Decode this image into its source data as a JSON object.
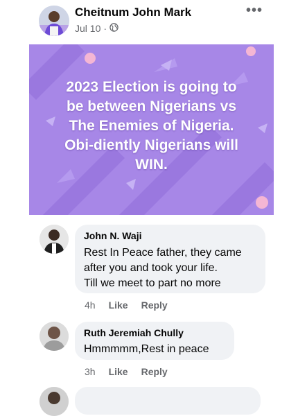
{
  "post": {
    "author": "Cheitnum John Mark",
    "date": "Jul 10",
    "separator": "·",
    "privacy_icon": "globe-icon",
    "more_label": "•••",
    "text": "2023 Election is going to\nbe between Nigerians vs\nThe Enemies of Nigeria.\nObi-diently Nigerians will\nWIN.",
    "background_color": "#a787e7"
  },
  "comments": [
    {
      "author": "John N. Waji",
      "lines": [
        "Rest In Peace father, they came",
        "after you and took your life.",
        "Till we meet to part no more"
      ],
      "time": "4h",
      "like": "Like",
      "reply": "Reply"
    },
    {
      "author": "Ruth Jeremiah Chully",
      "lines": [
        "Hmmmmm,Rest in peace"
      ],
      "time": "3h",
      "like": "Like",
      "reply": "Reply"
    }
  ],
  "colors": {
    "secondary_text": "#65676b",
    "bubble_bg": "#f0f2f5",
    "card_bg": "#a787e7"
  }
}
